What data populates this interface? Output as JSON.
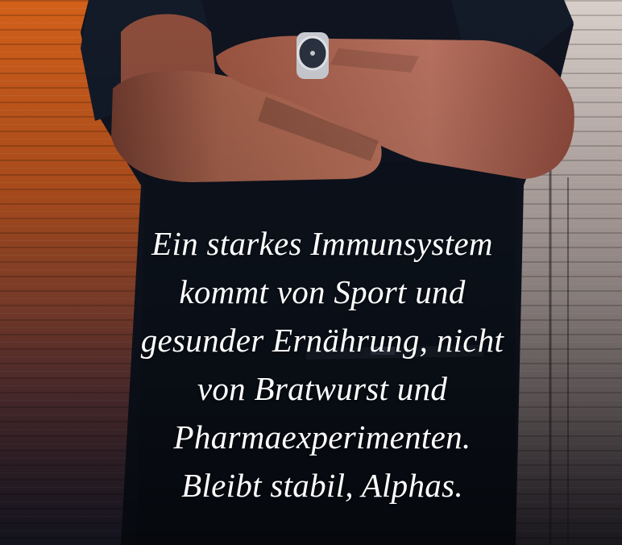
{
  "caption": {
    "lines": [
      "Ein starkes Immunsystem",
      "kommt von Sport und",
      "gesunder Ernährung, nicht",
      "von Bratwurst und",
      "Pharmaexperimenten.",
      "Bleibt stabil, Alphas."
    ]
  },
  "colors": {
    "text": "#ffffff",
    "background_warm": "#c8541a",
    "background_light": "#b9aca6",
    "shirt": "#0f1420",
    "skin": "#a05a44"
  }
}
